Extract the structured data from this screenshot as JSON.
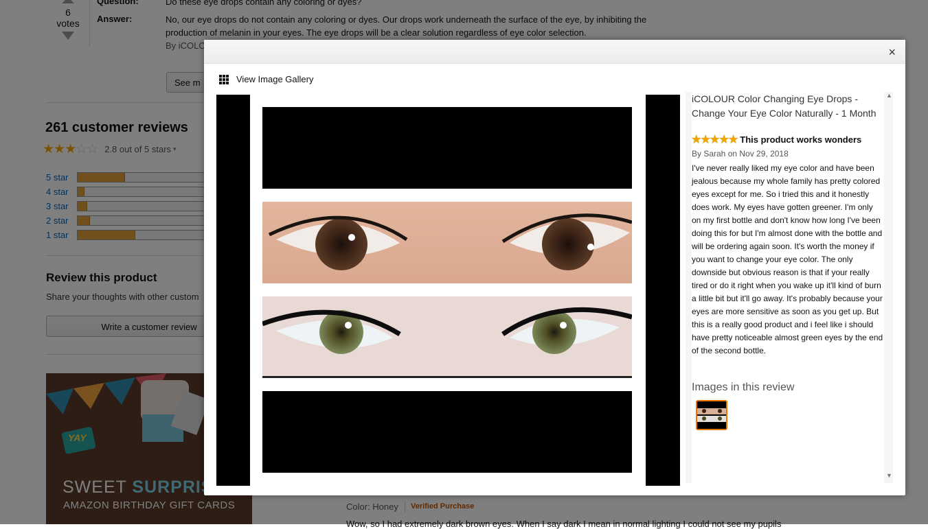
{
  "background_page": {
    "question_label": "Question:",
    "question_text": "Do these eye drops contain any coloring or dyes?",
    "answer_label": "Answer:",
    "answer_text_line1": "No, our eye drops do not contain any coloring or dyes. Our drops work underneath the surface of the eye, by inhibiting the",
    "answer_text_line2": "production of melanin in your eyes. The eye drops will be a clear solution regardless of eye color selection.",
    "answer_by": "By iCOLOUR",
    "votes_count": "6",
    "votes_label": "votes",
    "see_more_button": "See m",
    "reviews_heading": "261 customer reviews",
    "rating_text": "2.8 out of 5 stars",
    "rating_value": 2.8,
    "star_rows": [
      {
        "label": "5 star",
        "percent": 36
      },
      {
        "label": "4 star",
        "percent": 5
      },
      {
        "label": "3 star",
        "percent": 7
      },
      {
        "label": "2 star",
        "percent": 9
      },
      {
        "label": "1 star",
        "percent": 44
      }
    ],
    "review_product_heading": "Review this product",
    "review_product_sub": "Share your thoughts with other custom",
    "write_review_button": "Write a customer review",
    "gift_card_line1_a": "SWEET",
    "gift_card_line1_b": "SURPRIS",
    "gift_card_line2": "AMAZON BIRTHDAY GIFT CARDS",
    "gift_card_badge": "YAY",
    "color_label": "Color: Honey",
    "verified_label": "Verified Purchase",
    "review_snippet": "Wow, so I had extremely dark brown eyes. When I say dark I mean in normal lighting I could not see my pupils"
  },
  "modal": {
    "close_label": "×",
    "view_gallery_label": "View Image Gallery",
    "product_title": "iCOLOUR Color Changing Eye Drops - Change Your Eye Color Naturally - 1 Month",
    "review_rating": 5,
    "review_headline": "This product works wonders",
    "review_by": "By Sarah on Nov 29, 2018",
    "review_body": "I've never really liked my eye color and have been jealous because my whole family has pretty colored eyes except for me. So i tried this and it honestly does work. My eyes have gotten greener. I'm only on my first bottle and don't know how long I've been doing this for but I'm almost done with the bottle and will be ordering again soon. It's worth the money if you want to change your eye color. The only downside but obvious reason is that if your really tired or do it right when you wake up it'll kind of burn a little bit but it'll go away. It's probably because your eyes are more sensitive as soon as you get up. But this is a really good product and i feel like i should have pretty noticeable almost green eyes by the end of the second bottle.",
    "images_heading": "Images in this review"
  },
  "colors": {
    "accent_link": "#0066c0",
    "star": "#f0a500",
    "bar_fill": "#e2a13a",
    "verified": "#c45500",
    "thumb_border": "#e77600"
  }
}
